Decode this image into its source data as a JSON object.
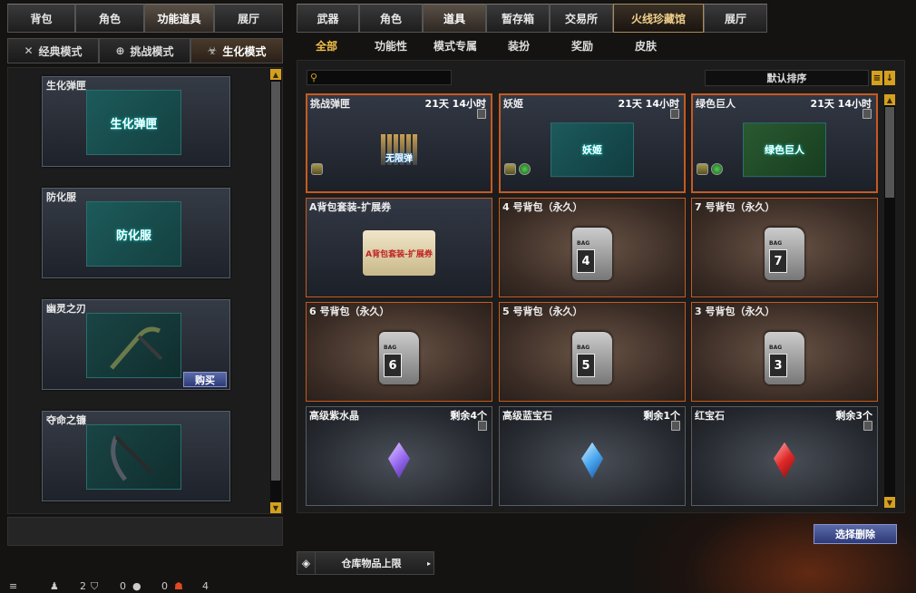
{
  "main_tabs_left": [
    "背包",
    "角色",
    "功能道具",
    "展厅"
  ],
  "main_tabs_left_active": 2,
  "mode_tabs": [
    {
      "icon": "crossed-swords-icon",
      "label": "经典模式"
    },
    {
      "icon": "crosshair-icon",
      "label": "挑战模式"
    },
    {
      "icon": "biohazard-icon",
      "label": "生化模式"
    }
  ],
  "mode_tabs_active": 2,
  "left_items": [
    {
      "name": "生化弹匣",
      "image_text": "生化弹匣"
    },
    {
      "name": "防化服",
      "image_text": "防化服"
    },
    {
      "name": "幽灵之刃",
      "image_text": "",
      "buy_label": "购买"
    },
    {
      "name": "夺命之镰",
      "image_text": ""
    }
  ],
  "main_tabs_right": [
    "武器",
    "角色",
    "道具",
    "暂存箱",
    "交易所",
    "火线珍藏馆",
    "展厅"
  ],
  "main_tabs_right_active": 2,
  "categories": [
    "全部",
    "功能性",
    "模式专属",
    "装扮",
    "奖励",
    "皮肤"
  ],
  "categories_active": 0,
  "search": {
    "placeholder": ""
  },
  "sort_label": "默认排序",
  "items": [
    {
      "name": "挑战弹匣",
      "status": "21天 14小时",
      "image_text": "无限弹",
      "kind": "magazine",
      "badges": 1
    },
    {
      "name": "妖姬",
      "status": "21天 14小时",
      "image_text": "妖姬",
      "kind": "char",
      "badges": 2
    },
    {
      "name": "绿色巨人",
      "status": "21天 14小时",
      "image_text": "绿色巨人",
      "kind": "char",
      "badges": 2
    },
    {
      "name": "A背包套装-扩展券",
      "status": "",
      "image_text": "A背包套装-扩展券",
      "kind": "ticket",
      "badges": 0
    },
    {
      "name": "4 号背包（永久）",
      "status": "",
      "bag_no": "4",
      "kind": "bag"
    },
    {
      "name": "7 号背包（永久）",
      "status": "",
      "bag_no": "7",
      "kind": "bag"
    },
    {
      "name": "6 号背包（永久）",
      "status": "",
      "bag_no": "6",
      "kind": "bag"
    },
    {
      "name": "5 号背包（永久）",
      "status": "",
      "bag_no": "5",
      "kind": "bag"
    },
    {
      "name": "3 号背包（永久）",
      "status": "",
      "bag_no": "3",
      "kind": "bag"
    },
    {
      "name": "高级紫水晶",
      "status": "剩余4个",
      "kind": "gem",
      "color": "#9a6cf0"
    },
    {
      "name": "高级蓝宝石",
      "status": "剩余1个",
      "kind": "gem",
      "color": "#4aa8f0"
    },
    {
      "name": "红宝石",
      "status": "剩余3个",
      "kind": "gem",
      "color": "#e02828"
    }
  ],
  "bag_label": "BAG",
  "select_delete_label": "选择删除",
  "storage_limit_label": "仓库物品上限",
  "status_bar": {
    "count_a": "2",
    "count_b": "0",
    "count_c": "0",
    "count_d": "4"
  },
  "colors": {
    "accent_gold": "#d4a020",
    "highlight_orange": "#c75a20",
    "button_blue": "#3a4a90"
  }
}
